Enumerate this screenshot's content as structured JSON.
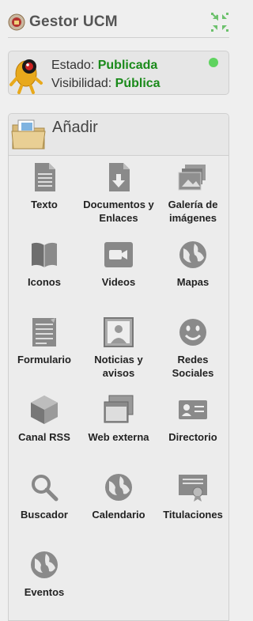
{
  "header": {
    "app_title": "Gestor UCM",
    "logo_icon": "ucm-seal-icon",
    "collapse_icon": "collapse-arrows-icon"
  },
  "status": {
    "estado_label": "Estado:",
    "estado_value": "Publicada",
    "visibilidad_label": "Visibilidad:",
    "visibilidad_value": "Pública",
    "indicator_color": "#5fd35f",
    "value_color": "#1a8a1a"
  },
  "add": {
    "title": "Añadir",
    "tools": [
      {
        "label": "Texto",
        "icon": "document-text-icon"
      },
      {
        "label": "Documentos y Enlaces",
        "icon": "document-download-icon"
      },
      {
        "label": "Galería de imágenes",
        "icon": "image-gallery-icon"
      },
      {
        "label": "Iconos",
        "icon": "book-icon"
      },
      {
        "label": "Videos",
        "icon": "video-camera-icon"
      },
      {
        "label": "Mapas",
        "icon": "globe-icon"
      },
      {
        "label": "Formulario",
        "icon": "form-icon"
      },
      {
        "label": "Noticias y avisos",
        "icon": "news-portrait-icon"
      },
      {
        "label": "Redes Sociales",
        "icon": "smiley-icon"
      },
      {
        "label": "Canal RSS",
        "icon": "cube-icon"
      },
      {
        "label": "Web externa",
        "icon": "browser-windows-icon"
      },
      {
        "label": "Directorio",
        "icon": "contact-card-icon"
      },
      {
        "label": "Buscador",
        "icon": "magnifier-icon"
      },
      {
        "label": "Calendario",
        "icon": "globe-icon"
      },
      {
        "label": "Titulaciones",
        "icon": "diploma-icon"
      },
      {
        "label": "Eventos",
        "icon": "globe-icon"
      }
    ]
  }
}
